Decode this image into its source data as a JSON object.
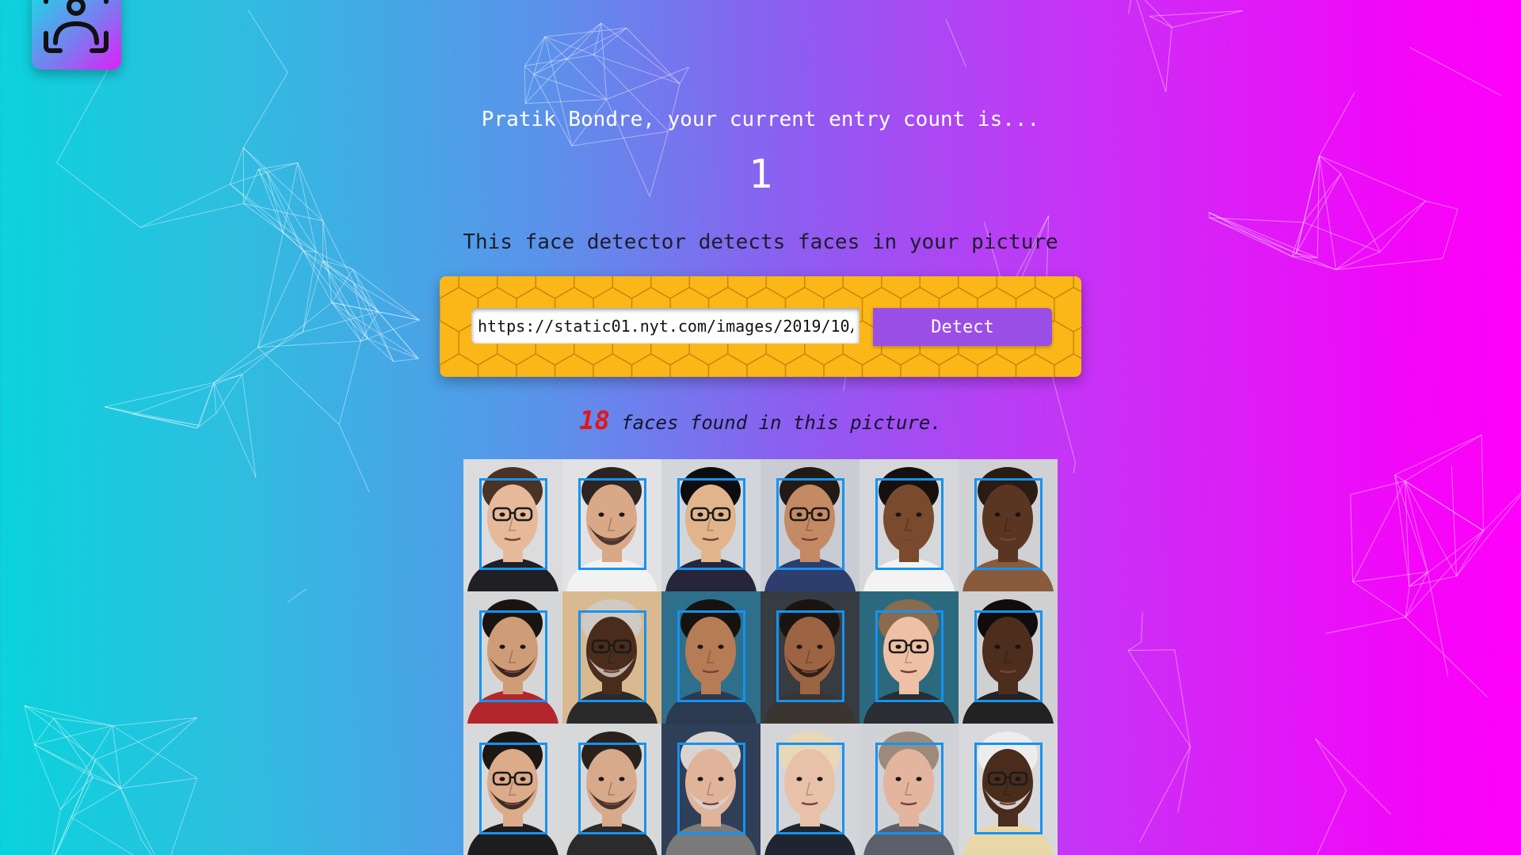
{
  "app": {
    "logo_icon": "face-scan-icon"
  },
  "greeting": {
    "text": "Pratik Bondre, your current entry count is...",
    "count": "1"
  },
  "subtitle": "This face detector detects faces in your picture",
  "form": {
    "url_value": "https://static01.nyt.com/images/2019/10/",
    "detect_label": "Detect"
  },
  "result": {
    "count": "18",
    "text": " faces found in this picture."
  },
  "colors": {
    "gradient_start": "#0ad3dc",
    "gradient_mid": "#8c5ef0",
    "gradient_end": "#ff00fa",
    "form_bg": "#fbb718",
    "button_bg": "#9b4ee6",
    "count_accent": "#e5141b",
    "face_box": "#1593f0"
  },
  "faces": [
    {
      "bg": "#dcdcdf",
      "skin": "#e6b99a",
      "hair": "#4a3324",
      "shirt": "#1f1f24",
      "glasses": true,
      "beard": false
    },
    {
      "bg": "#e2e2e4",
      "skin": "#d9a886",
      "hair": "#2c2420",
      "shirt": "#f2f2f2",
      "glasses": false,
      "beard": true
    },
    {
      "bg": "#d2d5d9",
      "skin": "#e2b48c",
      "hair": "#0d0d0f",
      "shirt": "#26263a",
      "glasses": true,
      "beard": false
    },
    {
      "bg": "#c9ccd2",
      "skin": "#c48a64",
      "hair": "#221a15",
      "shirt": "#2d3e6e",
      "glasses": true,
      "beard": false
    },
    {
      "bg": "#d6d7da",
      "skin": "#7a4a2e",
      "hair": "#15100d",
      "shirt": "#f3f3f3",
      "glasses": false,
      "beard": false
    },
    {
      "bg": "#cfd1d4",
      "skin": "#5a3622",
      "hair": "#2a1b13",
      "shirt": "#8a5a3c",
      "glasses": false,
      "beard": false
    },
    {
      "bg": "#d5d6d8",
      "skin": "#cf9c78",
      "hair": "#1a1411",
      "shirt": "#b5262c",
      "glasses": false,
      "beard": true
    },
    {
      "bg": "#d9ba90",
      "skin": "#4a2c1c",
      "hair": "#cfcac4",
      "shirt": "#2a2a2a",
      "glasses": true,
      "beard": true
    },
    {
      "bg": "#2e6f8c",
      "skin": "#b57c55",
      "hair": "#161210",
      "shirt": "#2b3a4f",
      "glasses": false,
      "beard": false
    },
    {
      "bg": "#373b42",
      "skin": "#9c6442",
      "hair": "#1a1411",
      "shirt": "#3a3530",
      "glasses": false,
      "beard": true
    },
    {
      "bg": "#2b6a7e",
      "skin": "#eec1a6",
      "hair": "#8a6b4b",
      "shirt": "#2a2d33",
      "glasses": true,
      "beard": false
    },
    {
      "bg": "#cfd0d2",
      "skin": "#4d2d1c",
      "hair": "#0f0c0b",
      "shirt": "#222222",
      "glasses": false,
      "beard": false
    },
    {
      "bg": "#d8d9db",
      "skin": "#dcab8a",
      "hair": "#1d1714",
      "shirt": "#1d1d1f",
      "glasses": true,
      "beard": true
    },
    {
      "bg": "#d7d8da",
      "skin": "#d8aa8c",
      "hair": "#2a211c",
      "shirt": "#2b2b2b",
      "glasses": false,
      "beard": true
    },
    {
      "bg": "#2f3f58",
      "skin": "#dfb49b",
      "hair": "#d8d5d1",
      "shirt": "#7a7a7a",
      "glasses": false,
      "beard": true
    },
    {
      "bg": "#d4d5d8",
      "skin": "#e7c2a8",
      "hair": "#e9d8b8",
      "shirt": "#1f2530",
      "glasses": false,
      "beard": false
    },
    {
      "bg": "#d1d2d5",
      "skin": "#e3b49e",
      "hair": "#9c8a7a",
      "shirt": "#5b5f69",
      "glasses": false,
      "beard": false
    },
    {
      "bg": "#d7d9dc",
      "skin": "#4a2c1c",
      "hair": "#ededed",
      "shirt": "#e8d7a8",
      "glasses": true,
      "beard": true
    }
  ]
}
